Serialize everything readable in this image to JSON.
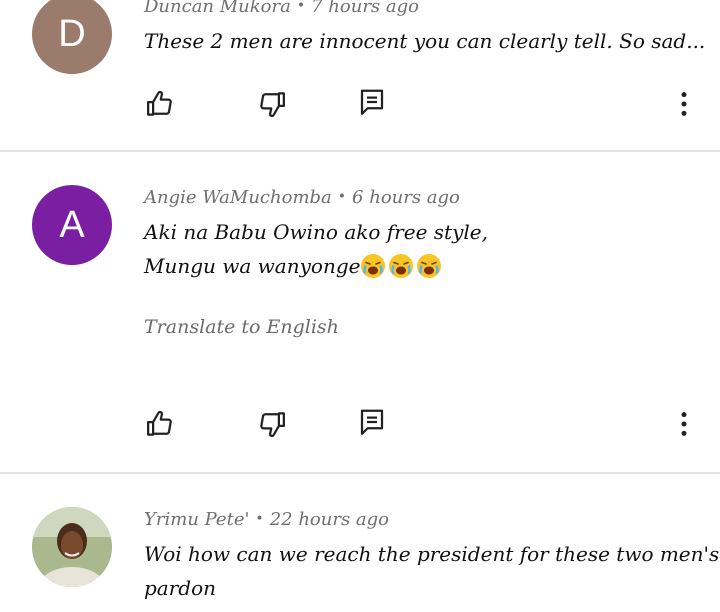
{
  "comments": [
    {
      "avatar_letter": "D",
      "avatar_color": "#9a7b6c",
      "author": "Duncan Mukora",
      "time": "7 hours ago",
      "lines": [
        "These 2 men are innocent you can clearly tell. So sad..."
      ]
    },
    {
      "avatar_letter": "A",
      "avatar_color": "#7b1fa2",
      "author": "Angie WaMuchomba",
      "time": "6 hours ago",
      "lines": [
        "Aki na Babu Owino ako free style,",
        "Mungu wa wanyonge"
      ],
      "emojis": [
        "crying-face-icon",
        "crying-face-icon",
        "crying-face-icon"
      ],
      "translate_label": "Translate to English"
    },
    {
      "author": "Yrimu Pete'",
      "time": "22 hours ago",
      "lines": [
        "Woi how can we reach the president for these two men's",
        "pardon"
      ]
    }
  ],
  "separator": "•",
  "colors": {
    "divider": "#e3e3e3",
    "icon": "#222222",
    "meta_text": "#707070"
  }
}
